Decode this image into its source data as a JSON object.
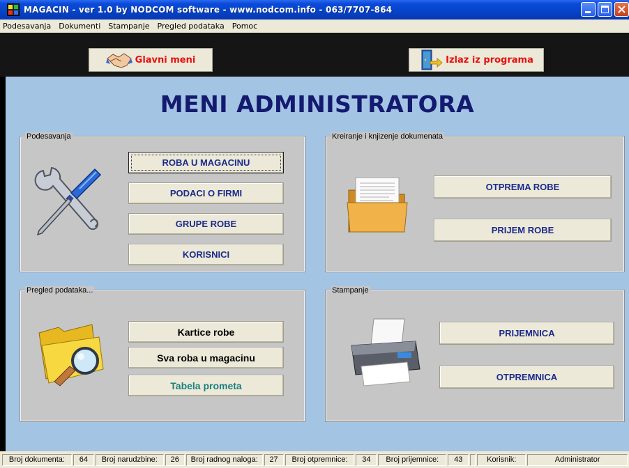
{
  "window": {
    "title": "MAGACIN - ver 1.0 by NODCOM software - www.nodcom.info - 063/7707-864"
  },
  "menu": [
    {
      "label": "Podesavanja"
    },
    {
      "label": "Dokumenti"
    },
    {
      "label": "Stampanje"
    },
    {
      "label": "Pregled podataka"
    },
    {
      "label": "Pomoc"
    }
  ],
  "toolbar": {
    "main_menu_label": "Glavni meni",
    "exit_label": "Izlaz iz programa"
  },
  "heading": "MENI ADMINISTRATORA",
  "groups": {
    "settings": {
      "legend": "Podesavanja",
      "buttons": [
        "ROBA U MAGACINU",
        "PODACI O FIRMI",
        "GRUPE ROBE",
        "KORISNICI"
      ]
    },
    "documents": {
      "legend": "Kreiranje i knjizenje dokumenata",
      "buttons": [
        "OTPREMA ROBE",
        "PRIJEM ROBE"
      ]
    },
    "overview": {
      "legend": "Pregled podataka...",
      "buttons": [
        "Kartice robe",
        "Sva roba u magacinu",
        "Tabela prometa"
      ]
    },
    "printing": {
      "legend": "Stampanje",
      "buttons": [
        "PRIJEMNICA",
        "OTPREMNICA"
      ]
    }
  },
  "status": {
    "doc_count_label": "Broj dokumenta:",
    "doc_count": "64",
    "orders_label": "Broj narudzbine:",
    "orders": "26",
    "work_orders_label": "Broj radnog naloga:",
    "work_orders": "27",
    "dispatch_label": "Broj otpremnice:",
    "dispatch": "34",
    "receipt_label": "Broj prijemnice:",
    "receipt": "43",
    "user_label": "Korisnik:",
    "user": "Administrator"
  },
  "colors": {
    "background": "#a4c4e4",
    "heading": "#141a70",
    "button_text": "#1a2a8c",
    "toolbar_text": "#e81010",
    "teal_text": "#1a8080"
  }
}
